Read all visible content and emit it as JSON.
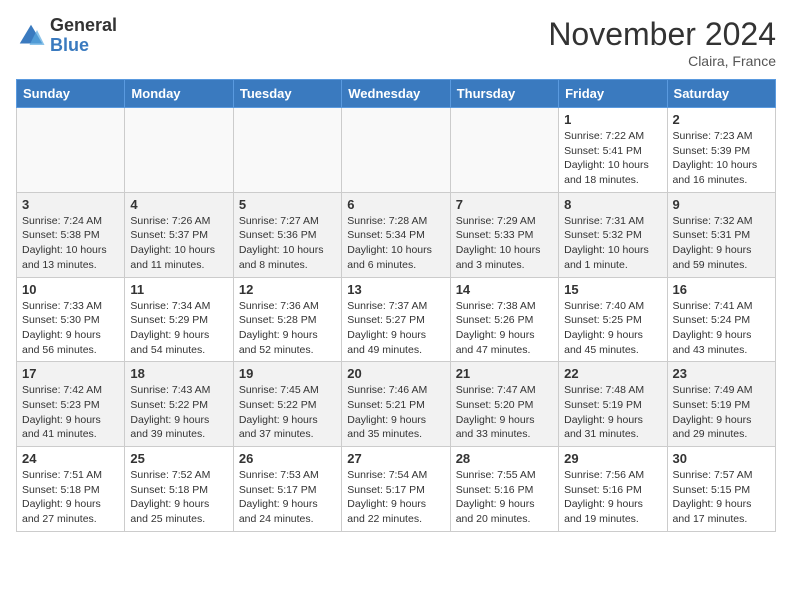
{
  "logo": {
    "general": "General",
    "blue": "Blue"
  },
  "title": "November 2024",
  "location": "Claira, France",
  "days_header": [
    "Sunday",
    "Monday",
    "Tuesday",
    "Wednesday",
    "Thursday",
    "Friday",
    "Saturday"
  ],
  "weeks": [
    [
      {
        "num": "",
        "info": ""
      },
      {
        "num": "",
        "info": ""
      },
      {
        "num": "",
        "info": ""
      },
      {
        "num": "",
        "info": ""
      },
      {
        "num": "",
        "info": ""
      },
      {
        "num": "1",
        "info": "Sunrise: 7:22 AM\nSunset: 5:41 PM\nDaylight: 10 hours and 18 minutes."
      },
      {
        "num": "2",
        "info": "Sunrise: 7:23 AM\nSunset: 5:39 PM\nDaylight: 10 hours and 16 minutes."
      }
    ],
    [
      {
        "num": "3",
        "info": "Sunrise: 7:24 AM\nSunset: 5:38 PM\nDaylight: 10 hours and 13 minutes."
      },
      {
        "num": "4",
        "info": "Sunrise: 7:26 AM\nSunset: 5:37 PM\nDaylight: 10 hours and 11 minutes."
      },
      {
        "num": "5",
        "info": "Sunrise: 7:27 AM\nSunset: 5:36 PM\nDaylight: 10 hours and 8 minutes."
      },
      {
        "num": "6",
        "info": "Sunrise: 7:28 AM\nSunset: 5:34 PM\nDaylight: 10 hours and 6 minutes."
      },
      {
        "num": "7",
        "info": "Sunrise: 7:29 AM\nSunset: 5:33 PM\nDaylight: 10 hours and 3 minutes."
      },
      {
        "num": "8",
        "info": "Sunrise: 7:31 AM\nSunset: 5:32 PM\nDaylight: 10 hours and 1 minute."
      },
      {
        "num": "9",
        "info": "Sunrise: 7:32 AM\nSunset: 5:31 PM\nDaylight: 9 hours and 59 minutes."
      }
    ],
    [
      {
        "num": "10",
        "info": "Sunrise: 7:33 AM\nSunset: 5:30 PM\nDaylight: 9 hours and 56 minutes."
      },
      {
        "num": "11",
        "info": "Sunrise: 7:34 AM\nSunset: 5:29 PM\nDaylight: 9 hours and 54 minutes."
      },
      {
        "num": "12",
        "info": "Sunrise: 7:36 AM\nSunset: 5:28 PM\nDaylight: 9 hours and 52 minutes."
      },
      {
        "num": "13",
        "info": "Sunrise: 7:37 AM\nSunset: 5:27 PM\nDaylight: 9 hours and 49 minutes."
      },
      {
        "num": "14",
        "info": "Sunrise: 7:38 AM\nSunset: 5:26 PM\nDaylight: 9 hours and 47 minutes."
      },
      {
        "num": "15",
        "info": "Sunrise: 7:40 AM\nSunset: 5:25 PM\nDaylight: 9 hours and 45 minutes."
      },
      {
        "num": "16",
        "info": "Sunrise: 7:41 AM\nSunset: 5:24 PM\nDaylight: 9 hours and 43 minutes."
      }
    ],
    [
      {
        "num": "17",
        "info": "Sunrise: 7:42 AM\nSunset: 5:23 PM\nDaylight: 9 hours and 41 minutes."
      },
      {
        "num": "18",
        "info": "Sunrise: 7:43 AM\nSunset: 5:22 PM\nDaylight: 9 hours and 39 minutes."
      },
      {
        "num": "19",
        "info": "Sunrise: 7:45 AM\nSunset: 5:22 PM\nDaylight: 9 hours and 37 minutes."
      },
      {
        "num": "20",
        "info": "Sunrise: 7:46 AM\nSunset: 5:21 PM\nDaylight: 9 hours and 35 minutes."
      },
      {
        "num": "21",
        "info": "Sunrise: 7:47 AM\nSunset: 5:20 PM\nDaylight: 9 hours and 33 minutes."
      },
      {
        "num": "22",
        "info": "Sunrise: 7:48 AM\nSunset: 5:19 PM\nDaylight: 9 hours and 31 minutes."
      },
      {
        "num": "23",
        "info": "Sunrise: 7:49 AM\nSunset: 5:19 PM\nDaylight: 9 hours and 29 minutes."
      }
    ],
    [
      {
        "num": "24",
        "info": "Sunrise: 7:51 AM\nSunset: 5:18 PM\nDaylight: 9 hours and 27 minutes."
      },
      {
        "num": "25",
        "info": "Sunrise: 7:52 AM\nSunset: 5:18 PM\nDaylight: 9 hours and 25 minutes."
      },
      {
        "num": "26",
        "info": "Sunrise: 7:53 AM\nSunset: 5:17 PM\nDaylight: 9 hours and 24 minutes."
      },
      {
        "num": "27",
        "info": "Sunrise: 7:54 AM\nSunset: 5:17 PM\nDaylight: 9 hours and 22 minutes."
      },
      {
        "num": "28",
        "info": "Sunrise: 7:55 AM\nSunset: 5:16 PM\nDaylight: 9 hours and 20 minutes."
      },
      {
        "num": "29",
        "info": "Sunrise: 7:56 AM\nSunset: 5:16 PM\nDaylight: 9 hours and 19 minutes."
      },
      {
        "num": "30",
        "info": "Sunrise: 7:57 AM\nSunset: 5:15 PM\nDaylight: 9 hours and 17 minutes."
      }
    ]
  ]
}
